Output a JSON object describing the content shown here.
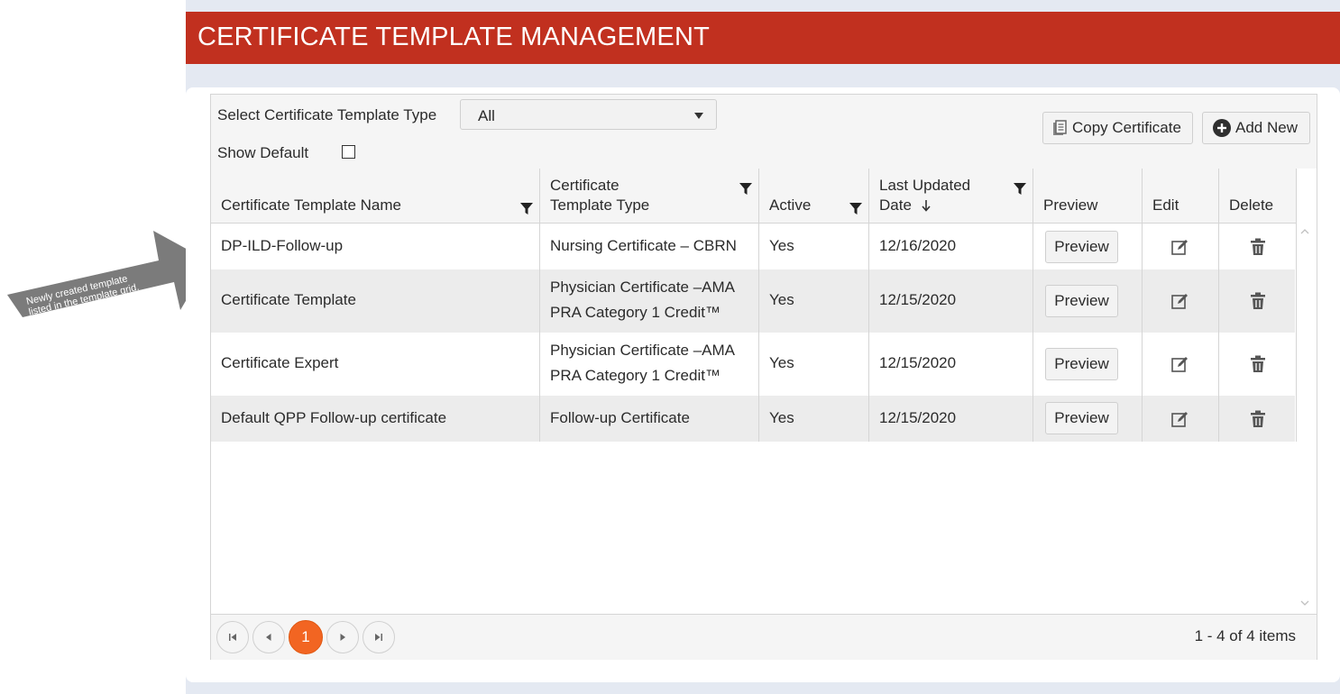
{
  "page": {
    "title": "CERTIFICATE TEMPLATE MANAGEMENT",
    "brand_color": "#c1301f",
    "accent_color": "#f26522"
  },
  "callout": {
    "line1": "Newly created template",
    "line2": "listed in the template grid."
  },
  "filters": {
    "type_label": "Select Certificate Template Type",
    "type_selected": "All",
    "show_default_label": "Show Default",
    "show_default_checked": false
  },
  "toolbar": {
    "copy_label": "Copy Certificate",
    "add_label": "Add New",
    "copy_icon": "copy-icon",
    "add_icon": "plus-circle-icon"
  },
  "columns": {
    "name": "Certificate Template Name",
    "type_line1": "Certificate",
    "type_line2": "Template Type",
    "active": "Active",
    "updated_line1": "Last Updated",
    "updated_line2": "Date",
    "preview": "Preview",
    "edit": "Edit",
    "delete": "Delete"
  },
  "rows": [
    {
      "name": "DP-ILD-Follow-up",
      "type1": "Nursing Certificate – CBRN",
      "type2": "",
      "active": "Yes",
      "date": "12/16/2020",
      "preview": "Preview"
    },
    {
      "name": "Certificate Template",
      "type1": "Physician Certificate –AMA",
      "type2": "PRA Category 1 Credit™",
      "active": "Yes",
      "date": "12/15/2020",
      "preview": "Preview"
    },
    {
      "name": "Certificate Expert",
      "type1": "Physician Certificate –AMA",
      "type2": "PRA Category 1 Credit™",
      "active": "Yes",
      "date": "12/15/2020",
      "preview": "Preview"
    },
    {
      "name": "Default QPP Follow-up certificate",
      "type1": "Follow-up Certificate",
      "type2": "",
      "active": "Yes",
      "date": "12/15/2020",
      "preview": "Preview"
    }
  ],
  "pager": {
    "current_page": "1",
    "info": "1 - 4 of 4 items"
  }
}
